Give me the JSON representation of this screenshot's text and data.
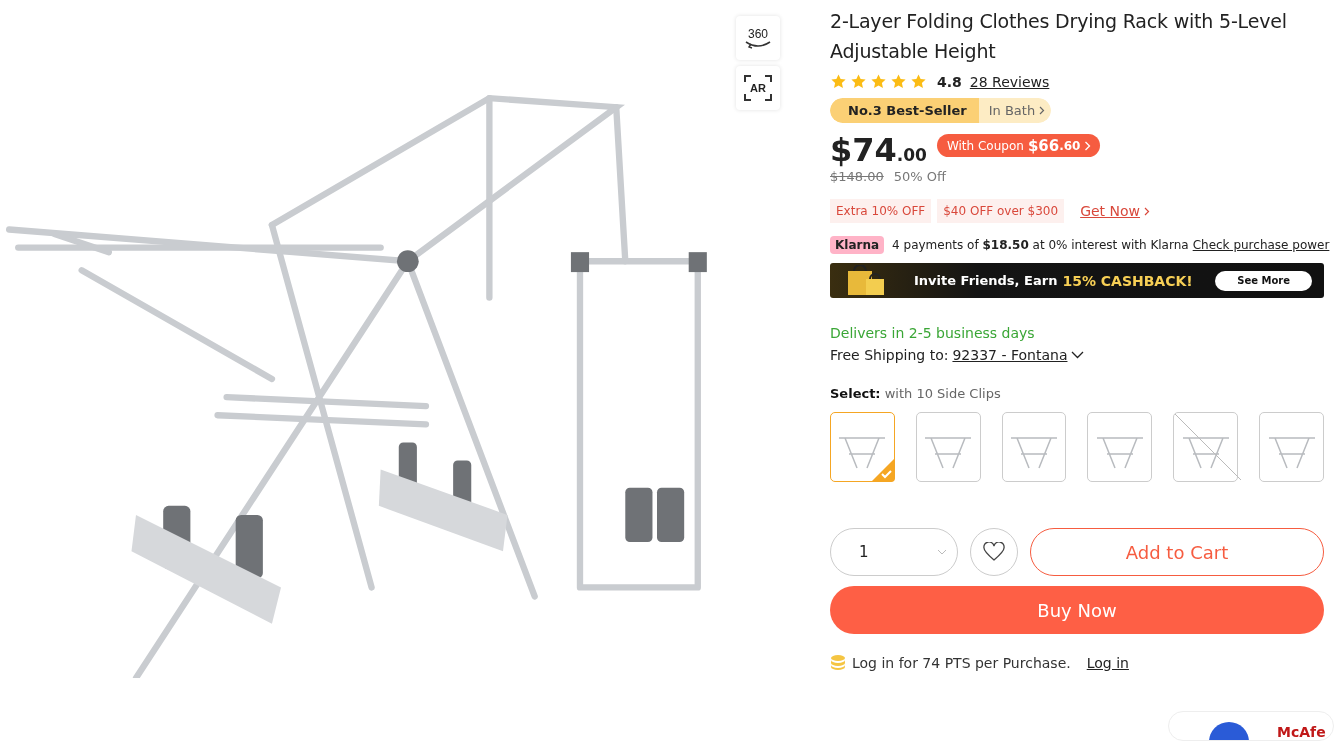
{
  "media_tools": [
    {
      "kind": "spin",
      "label": "360"
    },
    {
      "kind": "ar",
      "label": "AR"
    }
  ],
  "product": {
    "title": "2-Layer Folding Clothes Drying Rack with 5-Level Adjustable Height",
    "rating": {
      "stars": 5,
      "score": "4.8",
      "reviews": "28 Reviews"
    },
    "ranking": {
      "rank": "No.3 Best-Seller",
      "category": "In Bath"
    },
    "price": {
      "main": "$74",
      "cents": ".00",
      "coupon_label": "With Coupon",
      "coupon_main": "$66",
      "coupon_cents": ".60",
      "original": "$148.00",
      "discount": "50% Off"
    },
    "promos": [
      "Extra 10% OFF",
      "$40 OFF over $300"
    ],
    "promo_link": "Get Now",
    "klarna": {
      "badge": "Klarna",
      "text": "4 payments of **$18.50** at 0% interest with Klarna",
      "link": "Check purchase power"
    },
    "banner": {
      "text": "Invite Friends, Earn",
      "highlight": "15% CASHBACK!",
      "button": "See More"
    },
    "delivery": "Delivers in 2-5 business days",
    "shipping": {
      "label": "Free Shipping to:",
      "location": "92337 - Fontana"
    },
    "select_label": "**Select:** with 10 Side Clips",
    "variants": [
      {
        "selected": true,
        "disabled": false
      },
      {
        "selected": false,
        "disabled": false
      },
      {
        "selected": false,
        "disabled": false
      },
      {
        "selected": false,
        "disabled": false
      },
      {
        "selected": false,
        "disabled": true
      },
      {
        "selected": false,
        "disabled": false
      }
    ],
    "quantity": "1",
    "add_to_cart": "Add to Cart",
    "buy_now": "Buy Now",
    "points": {
      "text": "Log in for 74 PTS per Purchase.",
      "link": "Log in"
    },
    "trust_badge": "McAfe"
  }
}
